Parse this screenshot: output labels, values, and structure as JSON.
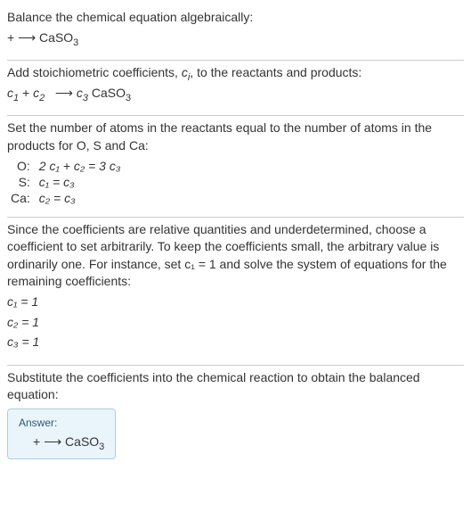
{
  "section1": {
    "intro": "Balance the chemical equation algebraically:",
    "eq_lhs": " + ",
    "arrow": "⟶",
    "eq_rhs": "CaSO",
    "eq_rhs_sub": "3"
  },
  "section2": {
    "intro_a": "Add stoichiometric coefficients, ",
    "ci": "c",
    "ci_sub": "i",
    "intro_b": ", to the reactants and products:",
    "c1": "c",
    "c1_sub": "1",
    "plus": " + ",
    "c2": "c",
    "c2_sub": "2",
    "arrow": "⟶",
    "c3": "c",
    "c3_sub": "3",
    "prod": " CaSO",
    "prod_sub": "3"
  },
  "section3": {
    "intro": "Set the number of atoms in the reactants equal to the number of atoms in the products for O, S and Ca:",
    "rows": [
      {
        "label": "O:",
        "eq": "2 c₁ + c₂ = 3 c₃"
      },
      {
        "label": "S:",
        "eq": "c₁ = c₃"
      },
      {
        "label": "Ca:",
        "eq": "c₂ = c₃"
      }
    ]
  },
  "section4": {
    "intro": "Since the coefficients are relative quantities and underdetermined, choose a coefficient to set arbitrarily. To keep the coefficients small, the arbitrary value is ordinarily one. For instance, set c₁ = 1 and solve the system of equations for the remaining coefficients:",
    "lines": [
      "c₁ = 1",
      "c₂ = 1",
      "c₃ = 1"
    ]
  },
  "section5": {
    "intro": "Substitute the coefficients into the chemical reaction to obtain the balanced equation:",
    "answer_label": "Answer:",
    "eq_lhs": " + ",
    "arrow": "⟶",
    "eq_rhs": "CaSO",
    "eq_rhs_sub": "3"
  }
}
